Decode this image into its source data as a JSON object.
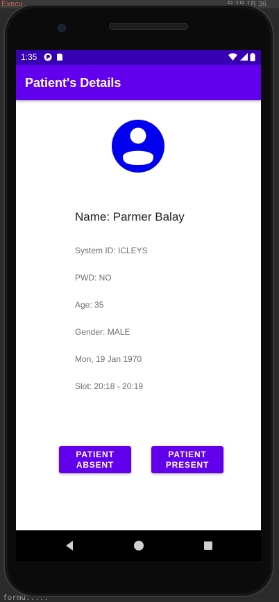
{
  "desktop": {
    "top_left_text": "Execu",
    "top_right_text": "R 1B 1B 36",
    "bottom_text": "formu....."
  },
  "status_bar": {
    "time": "1:35",
    "left_icons": [
      "location-pin-icon",
      "sd-card-icon"
    ],
    "right_icons": [
      "wifi-icon",
      "signal-icon",
      "battery-icon"
    ]
  },
  "app_bar": {
    "title": "Patient's Details"
  },
  "patient": {
    "avatar_icon": "account-circle-icon",
    "name": "Name: Parmer Balay",
    "system_id": "System ID: ICLEYS",
    "pwd": "PWD: NO",
    "age": "Age: 35",
    "gender": "Gender: MALE",
    "date": "Mon, 19 Jan 1970",
    "slot": "Slot: 20:18 - 20:19"
  },
  "actions": {
    "absent_line1": "PATIENT",
    "absent_line2": "ABSENT",
    "present_line1": "PATIENT",
    "present_line2": "PRESENT"
  },
  "nav_bar": {
    "buttons": [
      "back-icon",
      "home-icon",
      "recents-icon"
    ]
  },
  "colors": {
    "status_bar": "#3700b3",
    "app_bar": "#6200ee",
    "avatar": "#0000ee",
    "button": "#6200ee"
  }
}
